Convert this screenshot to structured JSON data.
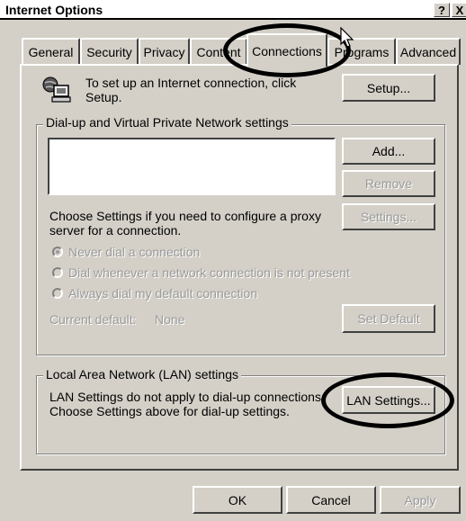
{
  "window": {
    "title": "Internet Options",
    "help_label": "?",
    "close_label": "X"
  },
  "tabs": [
    {
      "label": "General"
    },
    {
      "label": "Security"
    },
    {
      "label": "Privacy"
    },
    {
      "label": "Content"
    },
    {
      "label": "Connections",
      "active": true
    },
    {
      "label": "Programs"
    },
    {
      "label": "Advanced"
    }
  ],
  "setup": {
    "text": "To set up an Internet connection, click Setup.",
    "button": "Setup..."
  },
  "dialup": {
    "legend": "Dial-up and Virtual Private Network settings",
    "add": "Add...",
    "remove": "Remove",
    "settings_text": "Choose Settings if you need to configure a proxy server for a connection.",
    "settings": "Settings...",
    "radio_never": "Never dial a connection",
    "radio_whenever": "Dial whenever a network connection is not present",
    "radio_always": "Always dial my default connection",
    "current_default_label": "Current default:",
    "current_default_value": "None",
    "set_default": "Set Default"
  },
  "lan": {
    "legend": "Local Area Network (LAN) settings",
    "text": "LAN Settings do not apply to dial-up connections. Choose Settings above for dial-up settings.",
    "button": "LAN Settings..."
  },
  "footer": {
    "ok": "OK",
    "cancel": "Cancel",
    "apply": "Apply"
  }
}
